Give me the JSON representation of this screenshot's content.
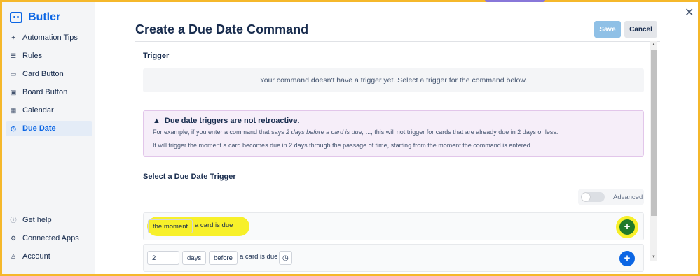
{
  "sidebar": {
    "brand": "Butler",
    "items": [
      {
        "label": "Automation Tips",
        "icon": "sparkle-icon"
      },
      {
        "label": "Rules",
        "icon": "sliders-icon"
      },
      {
        "label": "Card Button",
        "icon": "card-icon"
      },
      {
        "label": "Board Button",
        "icon": "board-icon"
      },
      {
        "label": "Calendar",
        "icon": "calendar-icon"
      },
      {
        "label": "Due Date",
        "icon": "clock-icon",
        "active": true
      }
    ],
    "bottom_items": [
      {
        "label": "Get help",
        "icon": "info-icon"
      },
      {
        "label": "Connected Apps",
        "icon": "gear-icon"
      },
      {
        "label": "Account",
        "icon": "person-icon"
      }
    ]
  },
  "header": {
    "title": "Create a Due Date Command",
    "save_label": "Save",
    "cancel_label": "Cancel"
  },
  "trigger": {
    "heading": "Trigger",
    "empty_message": "Your command doesn't have a trigger yet. Select a trigger for the command below."
  },
  "warning": {
    "heading": "Due date triggers are not retroactive.",
    "line1_prefix": "For example, if you enter a command that says",
    "line1_example": "2 days before a card is due,",
    "line1_suffix": "..., this will not trigger for cards that are already due in 2 days or less.",
    "line2": "It will trigger the moment a card becomes due in 2 days through the passage of time, starting from the moment the command is entered."
  },
  "select": {
    "heading": "Select a Due Date Trigger",
    "advanced_label": "Advanced",
    "row1": {
      "chip": "the moment",
      "text": "a card is due"
    },
    "row2": {
      "amount": "2",
      "unit": "days",
      "relation": "before",
      "text": "a card is due"
    }
  },
  "colors": {
    "accent": "#0c66e4",
    "highlight": "#f7f02a",
    "add_green": "#1f7a2a",
    "frame": "#f5b82b"
  }
}
